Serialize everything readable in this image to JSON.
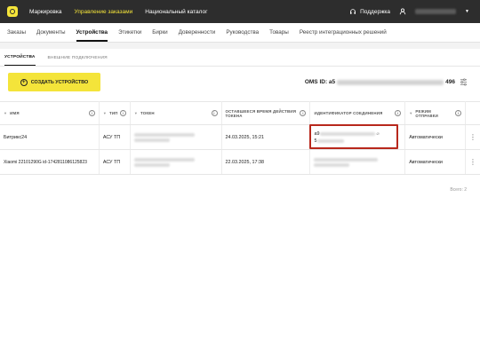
{
  "topbar": {
    "nav": [
      "Маркировка",
      "Управление заказами",
      "Национальный каталог"
    ],
    "active_index": 1,
    "support": "Поддержка"
  },
  "subnav": {
    "items": [
      "Заказы",
      "Документы",
      "Устройства",
      "Этикетки",
      "Бирки",
      "Доверенности",
      "Руководства",
      "Товары",
      "Реестр интеграционных решений"
    ],
    "active_index": 2
  },
  "tabs": [
    "УСТРОЙСТВА",
    "ВНЕШНИЕ ПОДКЛЮЧЕНИЯ"
  ],
  "create_button": "СОЗДАТЬ УСТРОЙСТВО",
  "oms": {
    "label": "OMS ID: a5",
    "suffix": "496"
  },
  "table": {
    "headers": [
      "ИМЯ",
      "ТИП",
      "ТОКЕН",
      "ОСТАВШЕЕСЯ ВРЕМЯ ДЕЙСТВИЯ ТОКЕНА",
      "ИДЕНТИФИКАТОР СОЕДИНЕНИЯ",
      "РЕЖИМ ОТПРАВКИ"
    ],
    "rows": [
      {
        "name": "Битрикс24",
        "type": "АСУ ТП",
        "expiry": "24.03.2025, 15:21",
        "conn_start": "a9",
        "conn_end": "5",
        "mode": "Автоматически"
      },
      {
        "name": "Xiaomi 22101290G id-1742811086125823",
        "type": "АСУ ТП",
        "expiry": "22.03.2025, 17:38",
        "conn_start": "",
        "conn_end": "",
        "mode": "Автоматически"
      }
    ],
    "total": "Всего: 2"
  },
  "colors": {
    "accent": "#f4e43a",
    "topbar": "#2d2d2d",
    "highlight": "#b8281c"
  }
}
